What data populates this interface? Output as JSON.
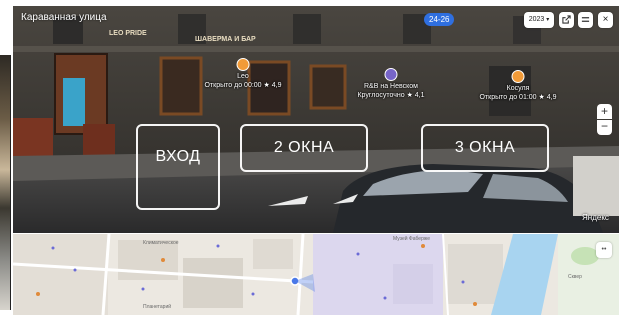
{
  "panorama": {
    "street_name": "Караванная улица",
    "time_badge": "24-26",
    "year_select": {
      "value": "2023",
      "caret": "▾"
    },
    "share_icon": "share-icon",
    "menu_icon": "menu-icon",
    "close_label": "×",
    "zoom_in_label": "+",
    "zoom_out_label": "−",
    "attribution": "Яндекс",
    "storefront_signs": [
      "LEO PRIDE",
      "ШАВЕРМА И БАР"
    ],
    "pois": [
      {
        "name": "Leo",
        "hours": "Открыто до 00:00",
        "rating": "★ 4,9",
        "color": "#f29b38"
      },
      {
        "name": "R&B на Невском",
        "hours": "Круглосуточно",
        "rating": "★ 4,1",
        "color": "#7765c9"
      },
      {
        "name": "Косуля",
        "hours": "Открыто до 01:00",
        "rating": "★ 4,9",
        "color": "#f29b38"
      }
    ],
    "overlays": [
      {
        "label": "ВХОД"
      },
      {
        "label": "2 ОКНА"
      },
      {
        "label": "3 ОКНА"
      }
    ]
  },
  "map": {
    "labels": [
      "Климатическое",
      "Планетарий",
      "Музей Фаберже",
      "Сквер"
    ],
    "toggle_label": "••"
  }
}
